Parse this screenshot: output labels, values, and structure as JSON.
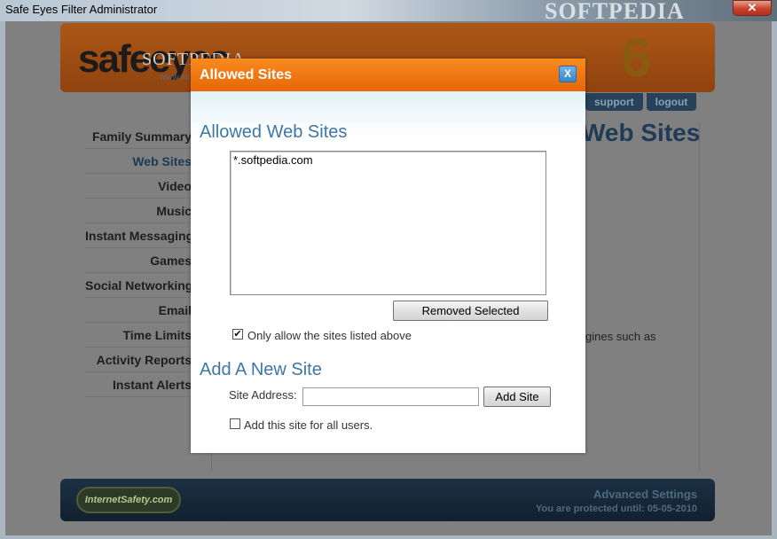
{
  "window": {
    "title": "Safe Eyes Filter Administrator",
    "watermark": "SOFTPEDIA",
    "close_glyph": "✕"
  },
  "app": {
    "logo": "safeeyes",
    "logo_watermark": "SOFTPEDIA",
    "logo_url": "www.softpedia.com",
    "version": "6",
    "top_nav": [
      "support",
      "logout"
    ],
    "sidebar": [
      {
        "label": "Family Summary"
      },
      {
        "label": "Web Sites"
      },
      {
        "label": "Video"
      },
      {
        "label": "Music"
      },
      {
        "label": "Instant Messaging"
      },
      {
        "label": "Games"
      },
      {
        "label": "Social Networking"
      },
      {
        "label": "Email"
      },
      {
        "label": "Time Limits"
      },
      {
        "label": "Activity Reports"
      },
      {
        "label": "Instant Alerts"
      }
    ],
    "page_heading": "Web Sites",
    "partial_text": "gines such as",
    "footer": {
      "logo_text": "InternetSafety.com",
      "title": "Advanced Settings",
      "status": "You are protected until: 05-05-2010"
    }
  },
  "dialog": {
    "title": "Allowed Sites",
    "close_glyph": "X",
    "allowed_heading": "Allowed Web Sites",
    "sites": [
      "*.softpedia.com"
    ],
    "remove_button": "Removed Selected",
    "only_allow_label": "Only allow the sites listed above",
    "only_allow_checked": true,
    "add_heading": "Add A New Site",
    "site_address_label": "Site Address:",
    "site_address_value": "",
    "add_button": "Add Site",
    "all_users_label": "Add this site for all users.",
    "all_users_checked": false
  }
}
